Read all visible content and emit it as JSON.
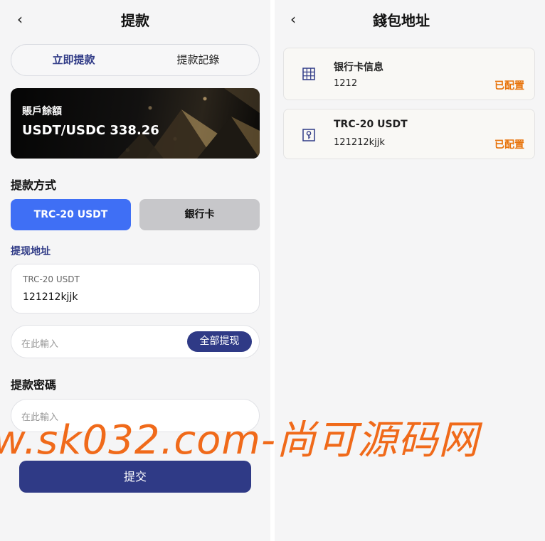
{
  "left": {
    "back_icon": "chevron-left-icon",
    "title": "提款",
    "tabs": [
      "立即提款",
      "提款記錄"
    ],
    "balance": {
      "label": "賬戶餘額",
      "amount": "USDT/USDC 338.26"
    },
    "method_section_title": "提款方式",
    "methods": [
      "TRC-20 USDT",
      "銀行卡"
    ],
    "address_title": "提现地址",
    "address": {
      "type": "TRC-20 USDT",
      "value": "121212kjjk"
    },
    "amount_input": {
      "placeholder": "在此輸入",
      "all_button": "全部提现"
    },
    "password_title": "提款密碼",
    "password_input": {
      "placeholder": "在此輸入"
    },
    "submit_label": "提交"
  },
  "right": {
    "back_icon": "chevron-left-icon",
    "title": "錢包地址",
    "cards": [
      {
        "icon": "bank-grid-icon",
        "name": "银行卡信息",
        "value": "1212",
        "status": "已配置"
      },
      {
        "icon": "key-icon",
        "name": "TRC-20 USDT",
        "value": "121212kjjk",
        "status": "已配置"
      }
    ]
  },
  "watermark": "w.sk032.com-尚可源码网",
  "colors": {
    "primary": "#2f3a86",
    "blue_button": "#3f6ff5",
    "status_orange": "#e8730a",
    "watermark": "#f06a1a"
  }
}
